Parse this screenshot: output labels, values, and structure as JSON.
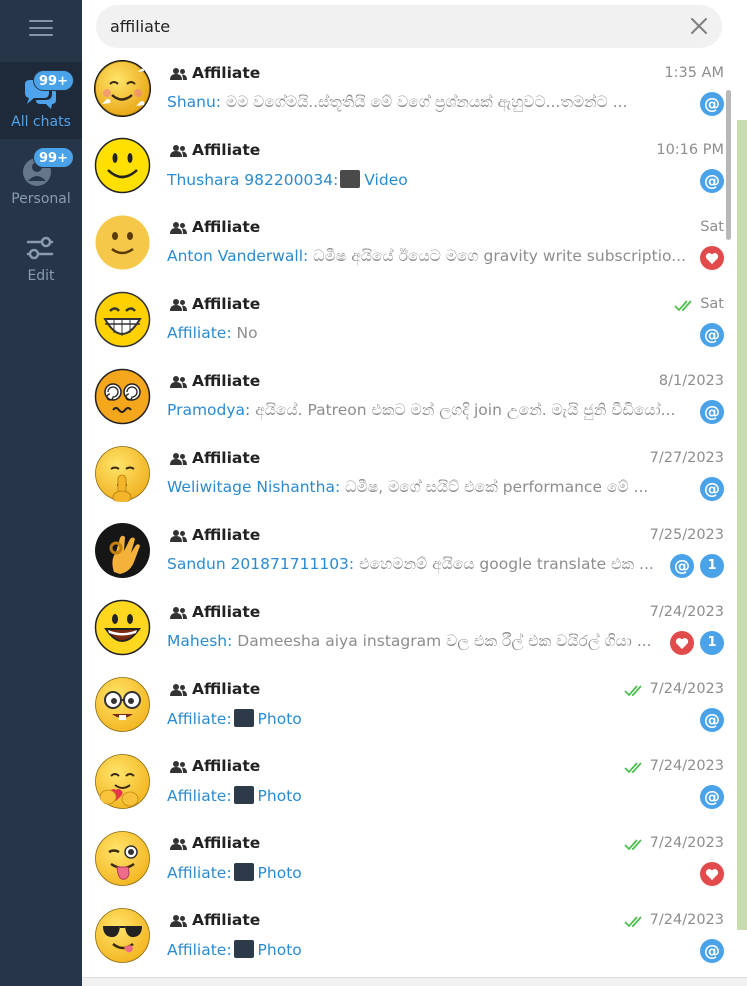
{
  "sidebar": {
    "folders": [
      {
        "label": "All chats",
        "badge": "99+",
        "icon": "chats-icon",
        "active": true
      },
      {
        "label": "Personal",
        "badge": "99+",
        "icon": "person-icon",
        "active": false
      },
      {
        "label": "Edit",
        "icon": "edit-icon",
        "active": false
      }
    ]
  },
  "search": {
    "value": "affiliate"
  },
  "chats": [
    {
      "title": "Affiliate",
      "time": "1:35 AM",
      "sender": "Shanu:",
      "text": " මම වගේමයි..ස්තූතියි මේ වගේ ප්‍රශ්නයක් ඇහුවට...තමන්ට ...",
      "badge": "@",
      "avatar": "smiling-face-hearts"
    },
    {
      "title": "Affiliate",
      "time": "10:16 PM",
      "sender": "Thushara 982200034:",
      "media": "Video",
      "badge": "@",
      "avatar": "smiley"
    },
    {
      "title": "Affiliate",
      "time": "Sat",
      "sender": "Anton Vanderwall:",
      "text": " ධමීෂ අයියේ ඊයෙට මගෙ gravity write subscriptio...",
      "badge": "heart",
      "avatar": "slight-smile"
    },
    {
      "title": "Affiliate",
      "time": "Sat",
      "sender": "Affiliate:",
      "text": " No",
      "badge": "@",
      "ticks": true,
      "avatar": "grin"
    },
    {
      "title": "Affiliate",
      "time": "8/1/2023",
      "sender": "Pramodya:",
      "text": " අයියේ. Patreon එකට මන් ලගදි join උනේ. මැයි ජුනි වීඩියෝ...",
      "badge": "@",
      "avatar": "dizzy"
    },
    {
      "title": "Affiliate",
      "time": "7/27/2023",
      "sender": "Weliwitage Nishantha:",
      "text": " ධමීෂ, මගේ සයිට් එකේ performance මේ ...",
      "badge": "@",
      "avatar": "shush"
    },
    {
      "title": "Affiliate",
      "time": "7/25/2023",
      "sender": "Sandun 201871711103:",
      "text": " එහෙමනම් අයියෙ google translate එක ...",
      "badge": "@",
      "unread": "1",
      "avatar": "ok-hand"
    },
    {
      "title": "Affiliate",
      "time": "7/24/2023",
      "sender": "Mahesh:",
      "text": " Dameesha aiya instagram වල එක රීල් එක වයිරල් ගියා ...",
      "badge": "heart",
      "unread": "1",
      "avatar": "big-smile"
    },
    {
      "title": "Affiliate",
      "time": "7/24/2023",
      "sender": "Affiliate:",
      "media": "Photo",
      "badge": "@",
      "ticks": true,
      "avatar": "nerd"
    },
    {
      "title": "Affiliate",
      "time": "7/24/2023",
      "sender": "Affiliate:",
      "media": "Photo",
      "badge": "@",
      "ticks": true,
      "avatar": "hug"
    },
    {
      "title": "Affiliate",
      "time": "7/24/2023",
      "sender": "Affiliate:",
      "media": "Photo",
      "badge": "heart",
      "ticks": true,
      "avatar": "wink-tongue"
    },
    {
      "title": "Affiliate",
      "time": "7/24/2023",
      "sender": "Affiliate:",
      "media": "Photo",
      "badge": "@",
      "ticks": true,
      "avatar": "sunglasses"
    }
  ],
  "colors": {
    "sidebar_bg": "#273549",
    "accent": "#4aa2e8",
    "sender": "#2a8bd1",
    "heart": "#e24b4b",
    "check": "#4fbf4f"
  }
}
